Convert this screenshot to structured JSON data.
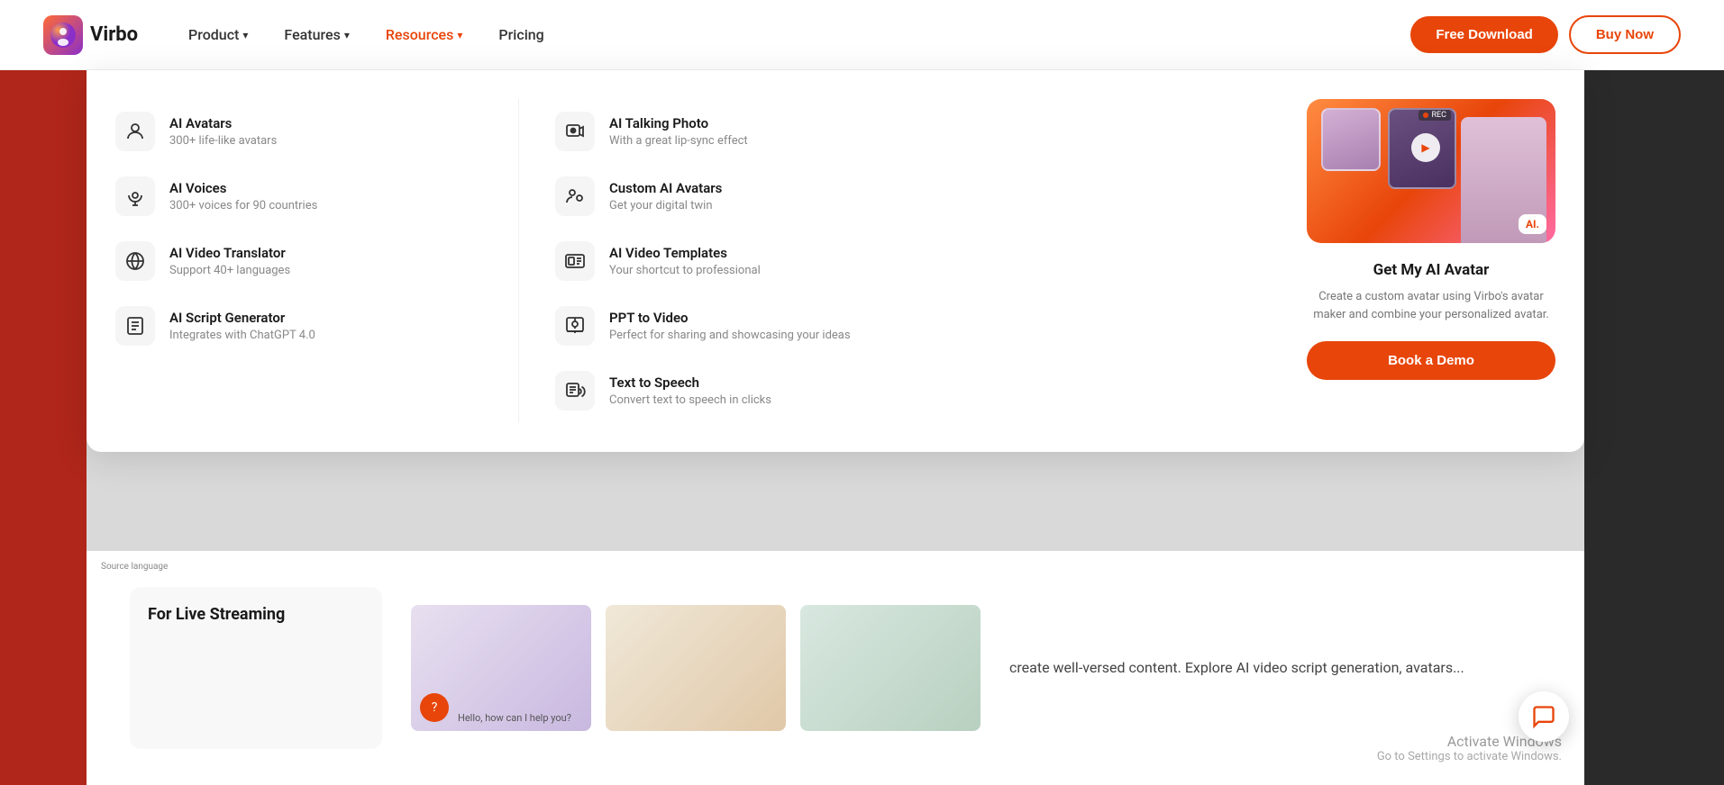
{
  "header": {
    "logo_text": "Virbo",
    "nav": [
      {
        "label": "Product",
        "has_dropdown": true,
        "active": false
      },
      {
        "label": "Features",
        "has_dropdown": true,
        "active": false
      },
      {
        "label": "Resources",
        "has_dropdown": true,
        "active": true
      },
      {
        "label": "Pricing",
        "has_dropdown": false,
        "active": false
      }
    ],
    "free_download_label": "Free Download",
    "buy_now_label": "Buy Now"
  },
  "dropdown": {
    "left_items": [
      {
        "id": "ai-avatars",
        "title": "AI Avatars",
        "subtitle": "300+ life-like avatars",
        "icon": "avatar-icon"
      },
      {
        "id": "ai-voices",
        "title": "AI Voices",
        "subtitle": "300+ voices for 90 countries",
        "icon": "voice-icon"
      },
      {
        "id": "ai-video-translator",
        "title": "AI Video Translator",
        "subtitle": "Support 40+ languages",
        "icon": "translate-icon"
      },
      {
        "id": "ai-script-generator",
        "title": "AI Script Generator",
        "subtitle": "Integrates with ChatGPT 4.0",
        "icon": "script-icon"
      }
    ],
    "right_items": [
      {
        "id": "ai-talking-photo",
        "title": "AI Talking Photo",
        "subtitle": "With a great lip-sync effect",
        "icon": "talking-photo-icon"
      },
      {
        "id": "custom-ai-avatars",
        "title": "Custom AI Avatars",
        "subtitle": "Get your digital twin",
        "icon": "custom-avatar-icon"
      },
      {
        "id": "ai-video-templates",
        "title": "AI Video Templates",
        "subtitle": "Your shortcut to professional",
        "icon": "video-templates-icon"
      },
      {
        "id": "ppt-to-video",
        "title": "PPT to Video",
        "subtitle": "Perfect for sharing and showcasing your ideas",
        "icon": "ppt-icon"
      },
      {
        "id": "text-to-speech",
        "title": "Text to Speech",
        "subtitle": "Convert text to speech in clicks",
        "icon": "tts-icon"
      }
    ],
    "card": {
      "title": "Get My AI Avatar",
      "description": "Create a custom avatar using Virbo's avatar maker and combine your personalized avatar.",
      "book_demo_label": "Book a Demo",
      "rec_badge": "●",
      "ai_badge": "AI."
    }
  },
  "bottom": {
    "live_streaming_label": "For Live Streaming",
    "body_text": "create well-versed content. Explore AI video script generation, avatars..."
  },
  "windows_watermark": {
    "line1": "Activate Windows",
    "line2": "Go to Settings to activate Windows."
  },
  "close_btn": "✕"
}
